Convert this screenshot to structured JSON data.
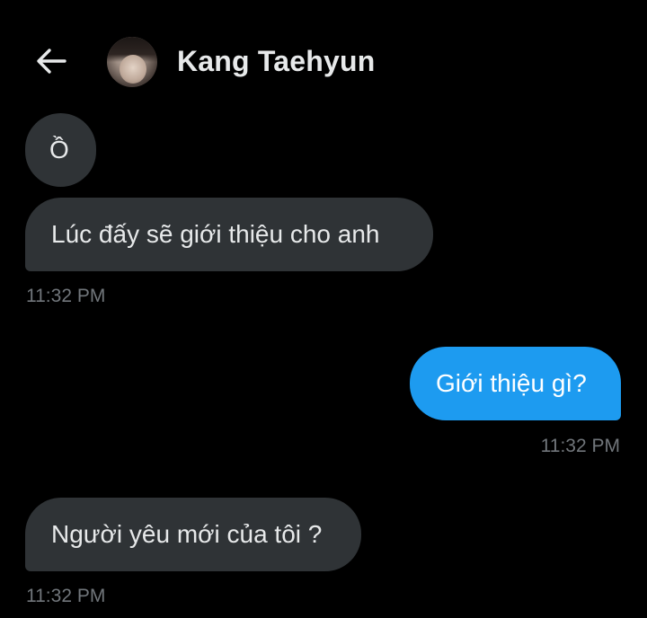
{
  "header": {
    "back_icon": "arrow-left-icon",
    "contact_name": "Kang Taehyun",
    "avatar_icon": "profile-photo"
  },
  "messages": [
    {
      "direction": "incoming",
      "text": "Ồ"
    },
    {
      "direction": "incoming",
      "text": "Lúc đấy sẽ giới thiệu cho anh",
      "time": "11:32 PM"
    },
    {
      "direction": "outgoing",
      "text": "Giới thiệu gì?",
      "time": "11:32 PM"
    },
    {
      "direction": "incoming",
      "text": "Người yêu mới của tôi ?",
      "time": "11:32 PM"
    }
  ],
  "colors": {
    "background": "#000000",
    "incoming_bubble": "#2f3336",
    "outgoing_bubble": "#1d9bf0",
    "text": "#e7e9ea",
    "timestamp": "#71767b"
  }
}
